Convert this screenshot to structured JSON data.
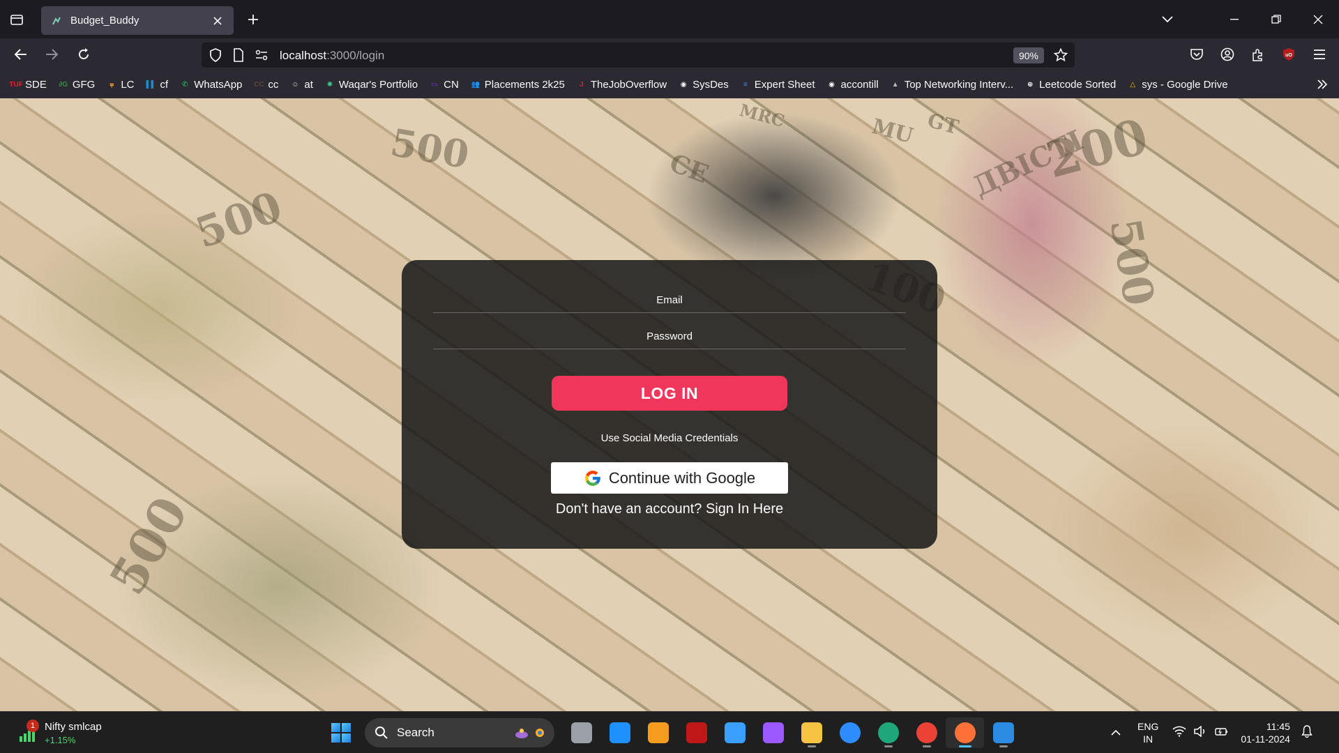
{
  "browser": {
    "tab": {
      "title": "Budget_Buddy"
    },
    "url": {
      "host": "localhost",
      "path": ":3000/login"
    },
    "zoom": "90%"
  },
  "bookmarks": [
    {
      "label": "SDE",
      "icon": "tuf-icon",
      "color": "#e0242e",
      "glyph": "TUF"
    },
    {
      "label": "GFG",
      "icon": "gfg-icon",
      "color": "#2f8d46",
      "glyph": "∂G"
    },
    {
      "label": "LC",
      "icon": "leetcode-icon",
      "color": "#ffa116",
      "glyph": "⩦"
    },
    {
      "label": "cf",
      "icon": "codeforces-icon",
      "color": "#1f8acb",
      "glyph": "▌▌"
    },
    {
      "label": "WhatsApp",
      "icon": "whatsapp-icon",
      "color": "#25d366",
      "glyph": "✆"
    },
    {
      "label": "cc",
      "icon": "codechef-icon",
      "color": "#5b4638",
      "glyph": "CC"
    },
    {
      "label": "at",
      "icon": "atcoder-icon",
      "color": "#dddddd",
      "glyph": "☺"
    },
    {
      "label": "Waqar's Portfolio",
      "icon": "portfolio-icon",
      "color": "#3ecf8e",
      "glyph": "✺"
    },
    {
      "label": "CN",
      "icon": "codingninjas-icon",
      "color": "#7b2ff7",
      "glyph": "▭"
    },
    {
      "label": "Placements 2k25",
      "icon": "group-icon",
      "color": "#5e8cff",
      "glyph": "👥"
    },
    {
      "label": "TheJobOverflow",
      "icon": "jobs-icon",
      "color": "#c22f2f",
      "glyph": "J"
    },
    {
      "label": "SysDes",
      "icon": "github-icon",
      "color": "#ffffff",
      "glyph": "◉"
    },
    {
      "label": "Expert Sheet",
      "icon": "sheet-icon",
      "color": "#4285f4",
      "glyph": "≡"
    },
    {
      "label": "accontill",
      "icon": "github-icon",
      "color": "#ffffff",
      "glyph": "◉"
    },
    {
      "label": "Top Networking Interv...",
      "icon": "mountain-icon",
      "color": "#bbbbbb",
      "glyph": "▲"
    },
    {
      "label": "Leetcode Sorted",
      "icon": "globe-icon",
      "color": "#ffffff",
      "glyph": "⊕"
    },
    {
      "label": "sys - Google Drive",
      "icon": "drive-icon",
      "color": "#fbbc04",
      "glyph": "△"
    }
  ],
  "login": {
    "email_placeholder": "Email",
    "password_placeholder": "Password",
    "login_button": "LOG IN",
    "social_text": "Use Social Media Credentials",
    "google_button": "Continue with Google",
    "signup_text": "Don't have an account? Sign In Here"
  },
  "background": {
    "bill_texts": [
      "500",
      "500",
      "200",
      "ДВІСТІ",
      "500",
      "CE",
      "MU",
      "GT",
      "MRC",
      "100",
      "500"
    ]
  },
  "taskbar": {
    "widget_title": "Nifty smlcap",
    "widget_change": "+1.15%",
    "widget_badge": "1",
    "search_label": "Search",
    "language": "ENG",
    "region": "IN",
    "time": "11:45",
    "date": "01-11-2024"
  }
}
